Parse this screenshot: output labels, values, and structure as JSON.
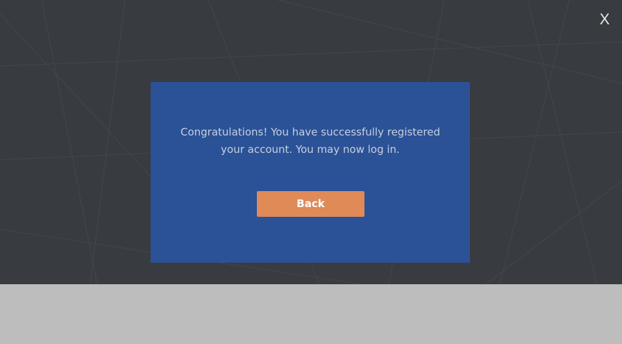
{
  "close": {
    "label": "X",
    "icon": "close-icon"
  },
  "dialog": {
    "message": "Congratulations! You have successfully registered your account. You may now log in.",
    "back_label": "Back"
  },
  "colors": {
    "background": "#383b40",
    "dialog": "#2b5296",
    "button": "#e08a58",
    "footer": "#bdbdbd"
  }
}
